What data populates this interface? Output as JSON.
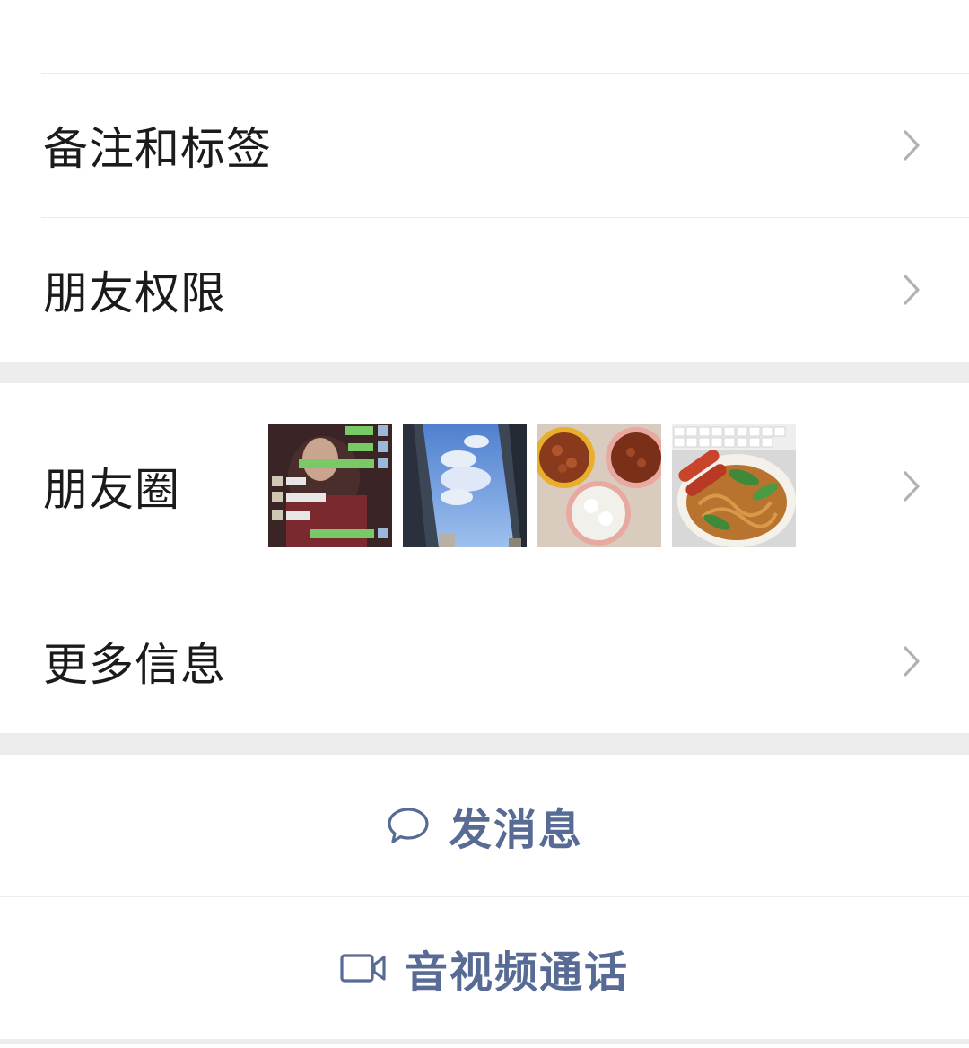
{
  "colors": {
    "link": "#576b95",
    "text": "#1b1b1b",
    "chevron": "#b2b2b2",
    "separator": "#ededed"
  },
  "rows": {
    "remarks": {
      "label": "备注和标签",
      "icon": "chevron-right-icon"
    },
    "permissions": {
      "label": "朋友权限",
      "icon": "chevron-right-icon"
    },
    "moments": {
      "label": "朋友圈",
      "icon": "chevron-right-icon",
      "thumbnails": [
        "chat-screenshot-thumbnail",
        "sky-buildings-thumbnail",
        "food-bowls-thumbnail",
        "noodles-sausage-thumbnail"
      ]
    },
    "more_info": {
      "label": "更多信息",
      "icon": "chevron-right-icon"
    }
  },
  "actions": {
    "message": {
      "label": "发消息",
      "icon": "chat-bubble-icon"
    },
    "call": {
      "label": "音视频通话",
      "icon": "video-camera-icon"
    }
  }
}
